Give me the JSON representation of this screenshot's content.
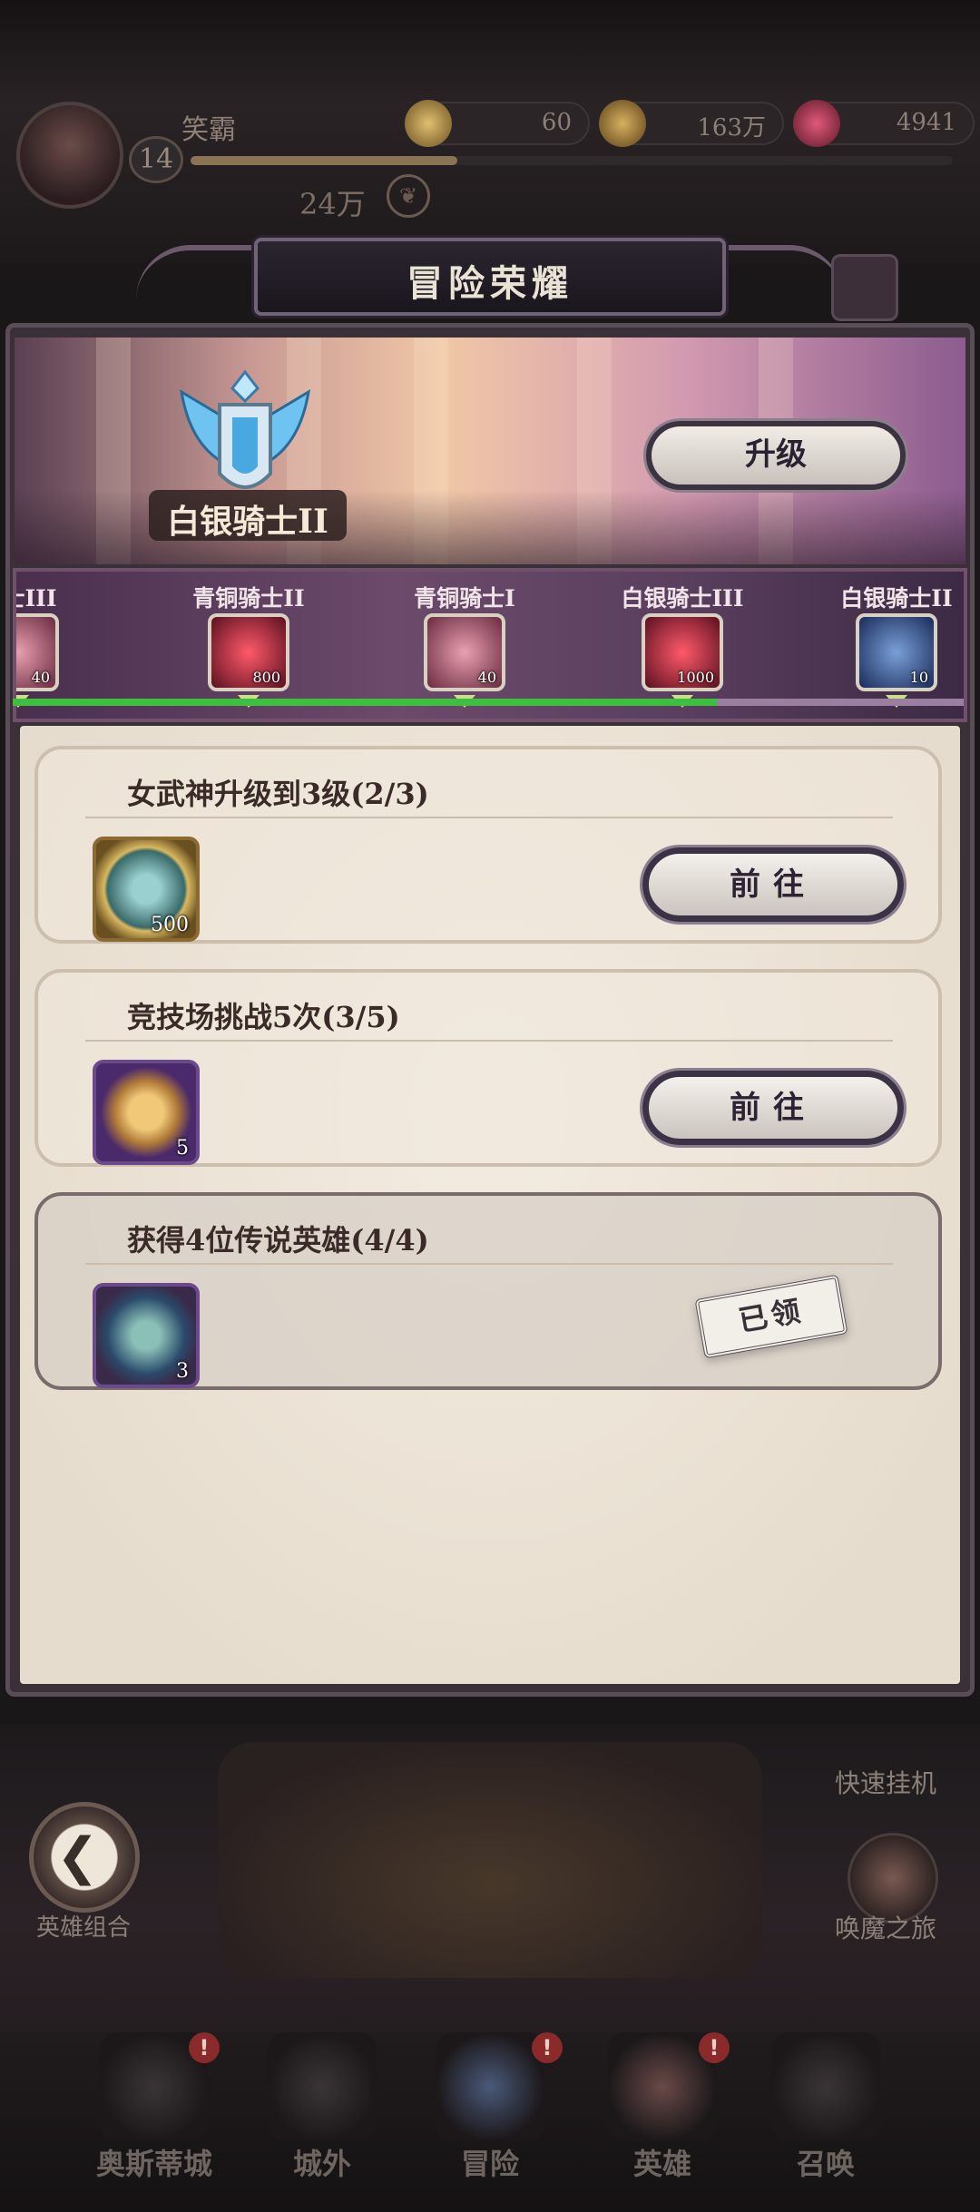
{
  "player": {
    "name": "笑霸",
    "level": "14",
    "exp_fraction": 0.35,
    "power": "24万",
    "power_icon": "laurel-icon"
  },
  "resources": [
    {
      "icon": "stamina-crystal-icon",
      "value": "60",
      "color": "#c9a24a"
    },
    {
      "icon": "gold-coin-icon",
      "value": "163万",
      "color": "#b08a3a"
    },
    {
      "icon": "red-gem-icon",
      "value": "4941",
      "color": "#b0304a"
    }
  ],
  "panel": {
    "title": "冒险荣耀",
    "rank": "白银骑士II",
    "upgrade_label": "升级"
  },
  "milestones": [
    {
      "label": "骑士III",
      "qty": "40",
      "item": "hero-shard-icon",
      "color": "#c46a78"
    },
    {
      "label": "青铜骑士II",
      "qty": "800",
      "item": "red-gem-icon",
      "color": "#d03a4a"
    },
    {
      "label": "青铜骑士I",
      "qty": "40",
      "item": "hero-shard-icon",
      "color": "#c46a78"
    },
    {
      "label": "白银骑士III",
      "qty": "1000",
      "item": "red-gem-icon",
      "color": "#d03a4a"
    },
    {
      "label": "白银骑士II",
      "qty": "10",
      "item": "scroll-icon",
      "color": "#3a5a9a"
    }
  ],
  "track_progress": 0.74,
  "tasks": [
    {
      "title": "女武神升级到3级(2/3)",
      "reward_icon": "valkyrie-coin-icon",
      "reward_qty": "500",
      "reward_color": "#5a8a8a",
      "action": "前往",
      "state": "go"
    },
    {
      "title": "竞技场挑战5次(3/5)",
      "reward_icon": "arena-ticket-icon",
      "reward_qty": "5",
      "reward_color": "#5a3a7a",
      "action": "前往",
      "state": "go"
    },
    {
      "title": "获得4位传说英雄(4/4)",
      "reward_icon": "scroll-icon",
      "reward_qty": "3",
      "reward_color": "#3a5a9a",
      "action": "已领",
      "state": "claimed"
    }
  ],
  "side_buttons": {
    "back_label": "英雄组合",
    "quick_label": "快速挂机",
    "summon_journey_label": "唤魔之旅"
  },
  "nav": [
    {
      "label": "奥斯蒂城",
      "badge": "!"
    },
    {
      "label": "城外",
      "badge": ""
    },
    {
      "label": "冒险",
      "badge": "!"
    },
    {
      "label": "英雄",
      "badge": "!"
    },
    {
      "label": "召唤",
      "badge": ""
    }
  ]
}
